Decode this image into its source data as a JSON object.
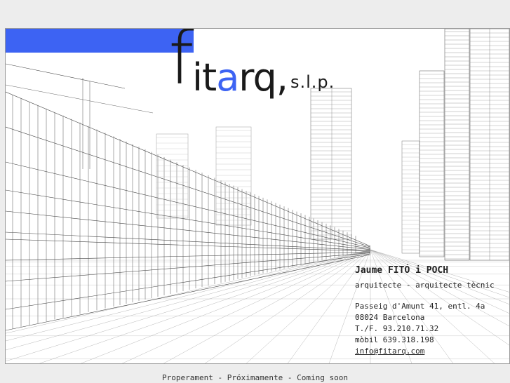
{
  "logo": {
    "letter_f": "f",
    "word_pre": "it",
    "word_accent": "a",
    "word_post": "rq,",
    "suffix": "s.l.p."
  },
  "contact": {
    "name": "Jaume FITÓ i POCH",
    "role": "arquitecte - arquitecte tècnic",
    "address_1": "Passeig d'Amunt 41, entl. 4a",
    "address_2": "08024 Barcelona",
    "phone": "T./F. 93.210.71.32",
    "mobile": "mòbil 639.318.198",
    "email": "info@fitarq.com"
  },
  "footer": {
    "text": "Properament - Próximamente - Coming soon"
  },
  "colors": {
    "accent": "#3d63f3",
    "background": "#ededed",
    "panel": "#ffffff"
  }
}
